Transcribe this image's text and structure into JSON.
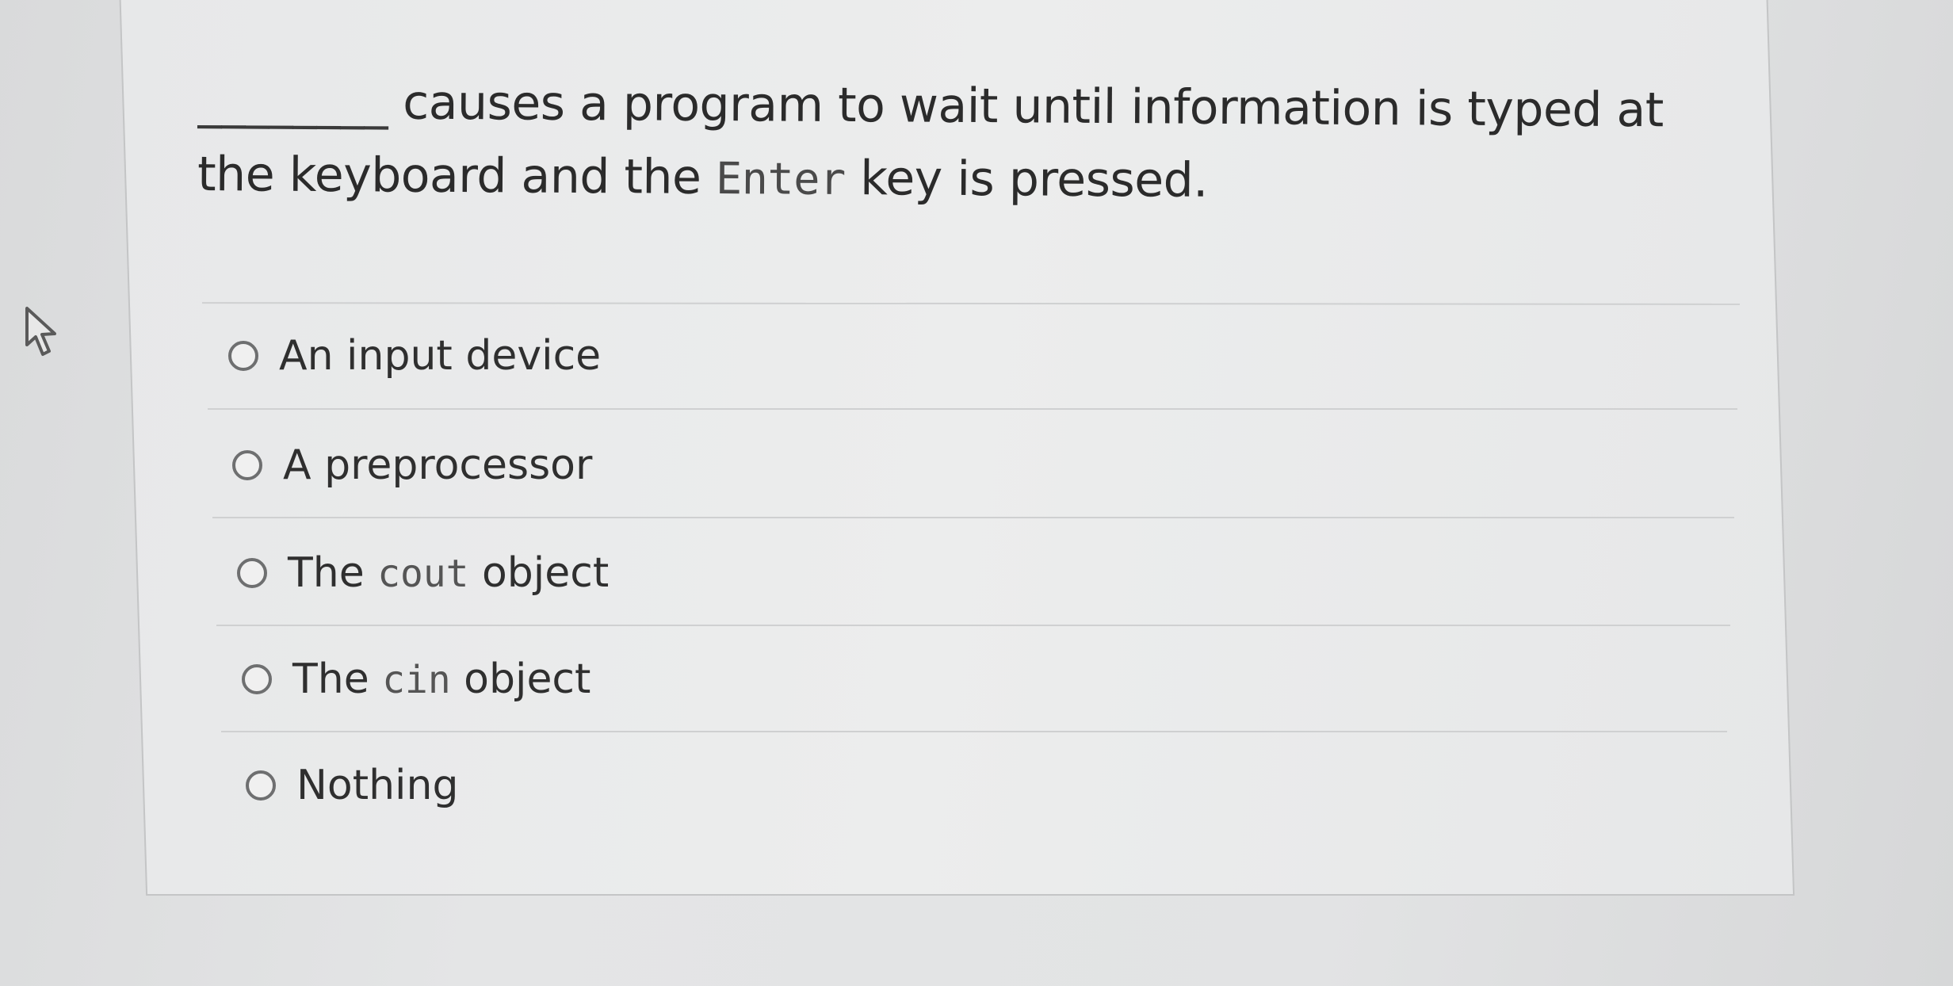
{
  "question": {
    "blank": "________",
    "text_part1": " causes a program to wait until information is typed at the keyboard and the ",
    "code_enter": "Enter",
    "text_part2": " key is pressed."
  },
  "options": [
    {
      "text": "An input device"
    },
    {
      "text": "A preprocessor"
    },
    {
      "prefix": "The ",
      "code": "cout",
      "suffix": " object"
    },
    {
      "prefix": "The ",
      "code": "cin",
      "suffix": " object"
    },
    {
      "text": "Nothing"
    }
  ],
  "icons": {
    "cursor": "mouse-pointer-icon",
    "radio": "radio-unchecked-icon"
  },
  "colors": {
    "background": "#e2e3e4",
    "card": "#eceded",
    "text": "#2e2e2e",
    "radio_border": "#6e6f70"
  }
}
